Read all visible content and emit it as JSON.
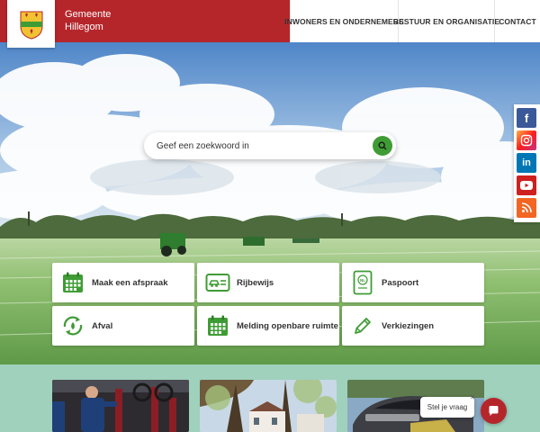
{
  "header": {
    "brand_line1": "Gemeente",
    "brand_line2": "Hillegom",
    "nav": [
      {
        "label": "INWONERS EN ONDERNEMERS"
      },
      {
        "label": "BESTUUR EN ORGANISATIE"
      },
      {
        "label": "CONTACT"
      }
    ]
  },
  "search": {
    "placeholder": "Geef een zoekwoord in",
    "icon": "search-icon"
  },
  "social": [
    {
      "name": "facebook",
      "glyph": "f",
      "color": "#3b5998"
    },
    {
      "name": "instagram",
      "glyph": "",
      "color": "#c13584"
    },
    {
      "name": "linkedin",
      "glyph": "in",
      "color": "#0077b5"
    },
    {
      "name": "youtube",
      "glyph": "",
      "color": "#cd201f"
    },
    {
      "name": "rss",
      "glyph": "",
      "color": "#f26522"
    }
  ],
  "tiles": [
    {
      "label": "Maak een afspraak",
      "icon": "calendar-icon"
    },
    {
      "label": "Rijbewijs",
      "icon": "driving-license-icon"
    },
    {
      "label": "Paspoort",
      "icon": "passport-icon"
    },
    {
      "label": "Afval",
      "icon": "recycle-icon"
    },
    {
      "label": "Melding openbare ruimte",
      "icon": "calendar-icon"
    },
    {
      "label": "Verkiezingen",
      "icon": "pencil-icon"
    }
  ],
  "chat": {
    "label": "Stel je vraag",
    "close": "×"
  },
  "colors": {
    "brand_red": "#b5262b",
    "accent_green": "#3f9c35",
    "icon_green": "#3f9c35",
    "section_bg": "#9fd1bd"
  }
}
